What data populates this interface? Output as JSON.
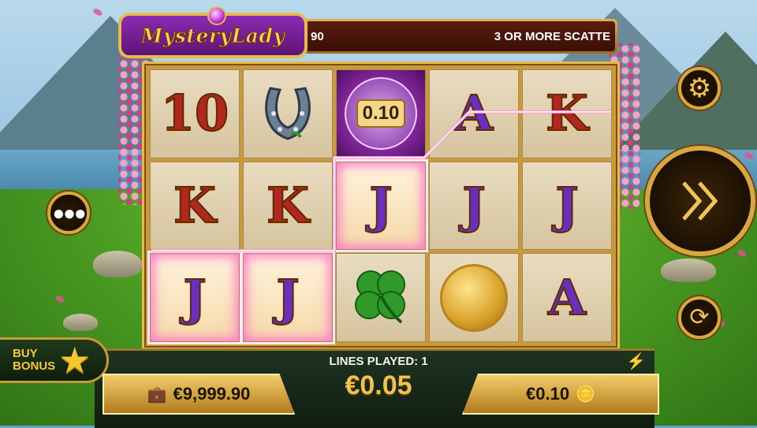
{
  "game": {
    "logo_text": "MysteryLady",
    "ticker_left": "90",
    "ticker_right": "3 OR MORE SCATTE"
  },
  "reels": [
    [
      {
        "kind": "text",
        "value": "10",
        "color": "red"
      },
      {
        "kind": "icon",
        "icon": "horseshoe-icon"
      },
      {
        "kind": "mystery",
        "value": "0.10"
      },
      {
        "kind": "text",
        "value": "A",
        "color": "purple"
      },
      {
        "kind": "text",
        "value": "K",
        "color": "red"
      }
    ],
    [
      {
        "kind": "text",
        "value": "K",
        "color": "red"
      },
      {
        "kind": "text",
        "value": "K",
        "color": "red"
      },
      {
        "kind": "text",
        "value": "J",
        "color": "purple",
        "win": true
      },
      {
        "kind": "text",
        "value": "J",
        "color": "purple"
      },
      {
        "kind": "text",
        "value": "J",
        "color": "purple"
      }
    ],
    [
      {
        "kind": "text",
        "value": "J",
        "color": "purple",
        "win": true
      },
      {
        "kind": "text",
        "value": "J",
        "color": "purple",
        "win": true
      },
      {
        "kind": "icon",
        "icon": "clover-icon"
      },
      {
        "kind": "icon",
        "icon": "coin-icon"
      },
      {
        "kind": "text",
        "value": "A",
        "color": "purple"
      }
    ]
  ],
  "status": {
    "lines_played": "LINES PLAYED: 1",
    "bet_amount": "€0.05",
    "balance": "€9,999.90",
    "coin_value": "€0.10"
  },
  "buttons": {
    "buy_bonus_line1": "BUY",
    "buy_bonus_line2": "BONUS"
  },
  "colors": {
    "accent_gold": "#e8b94b",
    "win_highlight": "#ff79c8",
    "symbol_purple": "#6a2fbf",
    "symbol_red": "#b3261e"
  }
}
